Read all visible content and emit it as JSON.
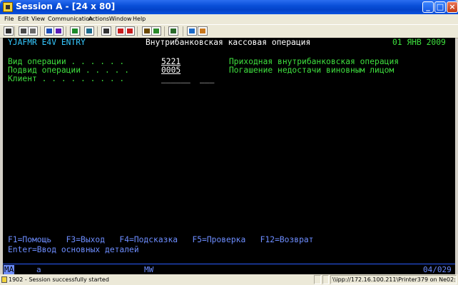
{
  "window": {
    "title": "Session A - [24 x 80]"
  },
  "menu": [
    "File",
    "Edit",
    "View",
    "Communication",
    "Actions",
    "Window",
    "Help"
  ],
  "toolbar": {
    "buttons": [
      {
        "name": "print-screen-icon",
        "color": "#2b2b2b"
      },
      {
        "name": "copy-icon",
        "color": "#4a4a4a"
      },
      {
        "name": "paste-icon",
        "color": "#6a6a6a"
      },
      {
        "name": "send-file-icon",
        "color": "#1a4db8"
      },
      {
        "name": "receive-file-icon",
        "color": "#5a1ab8"
      },
      {
        "name": "display-icon",
        "color": "#1a8a2a"
      },
      {
        "name": "keyboard-map-icon",
        "color": "#1a6a8a"
      },
      {
        "name": "macro-record-icon",
        "color": "#333333"
      },
      {
        "name": "macro-play-icon",
        "color": "#c81e1e"
      },
      {
        "name": "macro-stop-icon",
        "color": "#c81e1e"
      },
      {
        "name": "keypad-icon",
        "color": "#6a4a00"
      },
      {
        "name": "settings-icon",
        "color": "#2a8a2a"
      },
      {
        "name": "help-book-icon",
        "color": "#2a6a2a"
      },
      {
        "name": "globe-icon",
        "color": "#1a6ac8"
      },
      {
        "name": "tag-icon",
        "color": "#c8781e"
      }
    ]
  },
  "screen": {
    "header": {
      "program": "YJAFMR E4V ENTRY",
      "title": "Внутрибанковская кассовая операция",
      "date": "01 ЯНВ 2009"
    },
    "fields": {
      "op_type": {
        "label": "Вид операции . . . . . .",
        "value": "5221",
        "description": "Приходная внутрибанковская операция"
      },
      "op_subtype": {
        "label": "Подвид операции . . . . .",
        "value": "0005",
        "description": "Погашение недостачи виновным лицом"
      },
      "client": {
        "label": "Клиент . . . . . . . . .",
        "value1": "______",
        "value2": "___"
      }
    },
    "fkeys": {
      "line1": "F1=Помощь   F3=Выход   F4=Подсказка   F5=Проверка   F12=Возврат",
      "line2": "Enter=Ввод основных деталей"
    }
  },
  "oia": {
    "left": "MA",
    "indicator": "a",
    "mode": "MW",
    "cursor": "04/029"
  },
  "statusbar": {
    "message": "1902 - Session successfully started",
    "printer": "\\\\ipp://172.16.100.211\\Printer379 on Ne02:"
  },
  "colors": {
    "field_label": "#3ee03e",
    "header_program": "#35c8ff",
    "input_value": "#ffffff",
    "function_keys": "#6d8dff"
  }
}
